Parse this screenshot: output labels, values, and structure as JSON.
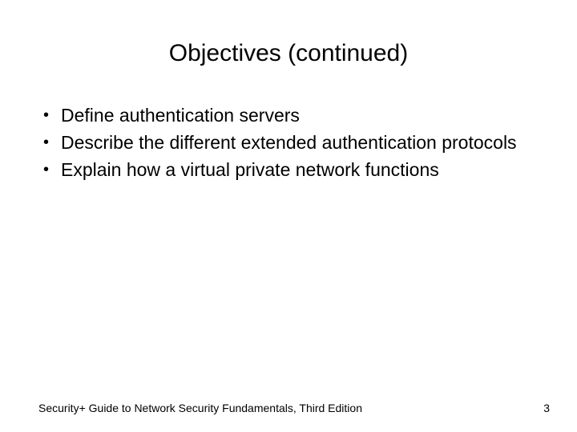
{
  "title": "Objectives (continued)",
  "bullets": [
    "Define authentication servers",
    "Describe the different extended authentication protocols",
    "Explain how a virtual private network functions"
  ],
  "footer": {
    "left": "Security+ Guide to Network Security Fundamentals, Third Edition",
    "page": "3"
  }
}
